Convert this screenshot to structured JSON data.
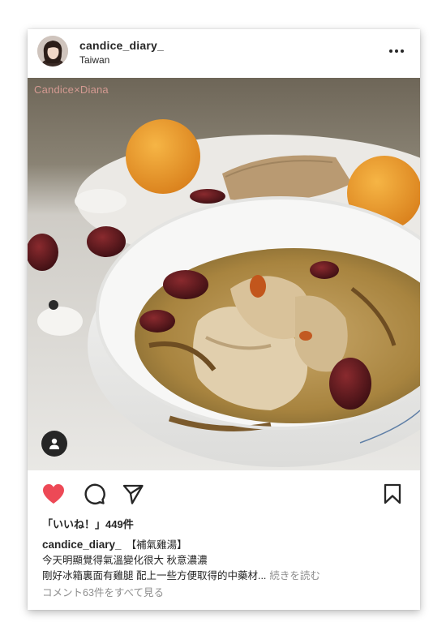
{
  "post": {
    "username": "candice_diary_",
    "location": "Taiwan",
    "watermark": "Candice×Diana",
    "likes_text": "「いいね！」449件",
    "caption_title": "【補氣雞湯】",
    "caption_line_1": "今天明顯覺得氣溫變化很大 秋意濃濃",
    "caption_line_2": "剛好冰箱裏面有雞腿 配上一些方便取得的中藥材...",
    "more_label": "続きを読む",
    "comments_link": "コメント63件をすべて見る"
  },
  "icons": {
    "more": "more-horizontal-icon",
    "like": "heart-filled-icon",
    "comment": "comment-bubble-icon",
    "share": "paper-plane-icon",
    "save": "bookmark-icon",
    "tag": "user-tag-icon"
  },
  "colors": {
    "like_active": "#ed4956",
    "text": "#262626",
    "muted": "#8e8e8e",
    "watermark": "#d49a92"
  }
}
